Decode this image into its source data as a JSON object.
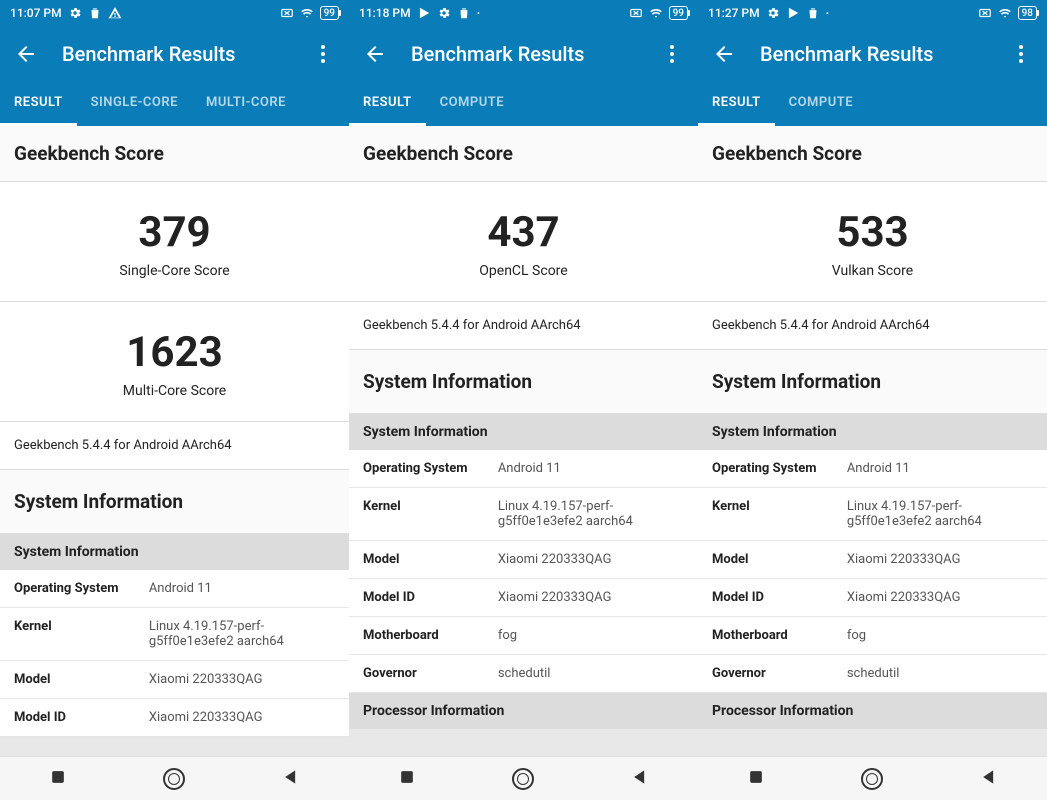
{
  "phones": [
    {
      "status_time": "11:07 PM",
      "status_battery": "99",
      "header_title": "Benchmark Results",
      "tabs": [
        {
          "label": "RESULT",
          "active": true
        },
        {
          "label": "SINGLE-CORE",
          "active": false
        },
        {
          "label": "MULTI-CORE",
          "active": false
        }
      ],
      "score_header": "Geekbench Score",
      "scores": [
        {
          "value": "379",
          "label": "Single-Core Score"
        },
        {
          "value": "1623",
          "label": "Multi-Core Score"
        }
      ],
      "version": "Geekbench 5.4.4 for Android AArch64",
      "sysinfo_header": "System Information",
      "sys_sub": "System Information",
      "rows": [
        {
          "key": "Operating System",
          "val": "Android 11"
        },
        {
          "key": "Kernel",
          "val": "Linux 4.19.157-perf-g5ff0e1e3efe2 aarch64"
        },
        {
          "key": "Model",
          "val": "Xiaomi 220333QAG"
        },
        {
          "key": "Model ID",
          "val": "Xiaomi 220333QAG"
        }
      ],
      "proc_sub": null
    },
    {
      "status_time": "11:18 PM",
      "status_battery": "99",
      "header_title": "Benchmark Results",
      "tabs": [
        {
          "label": "RESULT",
          "active": true
        },
        {
          "label": "COMPUTE",
          "active": false
        }
      ],
      "score_header": "Geekbench Score",
      "scores": [
        {
          "value": "437",
          "label": "OpenCL Score"
        }
      ],
      "version": "Geekbench 5.4.4 for Android AArch64",
      "sysinfo_header": "System Information",
      "sys_sub": "System Information",
      "rows": [
        {
          "key": "Operating System",
          "val": "Android 11"
        },
        {
          "key": "Kernel",
          "val": "Linux 4.19.157-perf-g5ff0e1e3efe2 aarch64"
        },
        {
          "key": "Model",
          "val": "Xiaomi 220333QAG"
        },
        {
          "key": "Model ID",
          "val": "Xiaomi 220333QAG"
        },
        {
          "key": "Motherboard",
          "val": "fog"
        },
        {
          "key": "Governor",
          "val": "schedutil"
        }
      ],
      "proc_sub": "Processor Information"
    },
    {
      "status_time": "11:27 PM",
      "status_battery": "98",
      "header_title": "Benchmark Results",
      "tabs": [
        {
          "label": "RESULT",
          "active": true
        },
        {
          "label": "COMPUTE",
          "active": false
        }
      ],
      "score_header": "Geekbench Score",
      "scores": [
        {
          "value": "533",
          "label": "Vulkan Score"
        }
      ],
      "version": "Geekbench 5.4.4 for Android AArch64",
      "sysinfo_header": "System Information",
      "sys_sub": "System Information",
      "rows": [
        {
          "key": "Operating System",
          "val": "Android 11"
        },
        {
          "key": "Kernel",
          "val": "Linux 4.19.157-perf-g5ff0e1e3efe2 aarch64"
        },
        {
          "key": "Model",
          "val": "Xiaomi 220333QAG"
        },
        {
          "key": "Model ID",
          "val": "Xiaomi 220333QAG"
        },
        {
          "key": "Motherboard",
          "val": "fog"
        },
        {
          "key": "Governor",
          "val": "schedutil"
        }
      ],
      "proc_sub": "Processor Information"
    }
  ]
}
